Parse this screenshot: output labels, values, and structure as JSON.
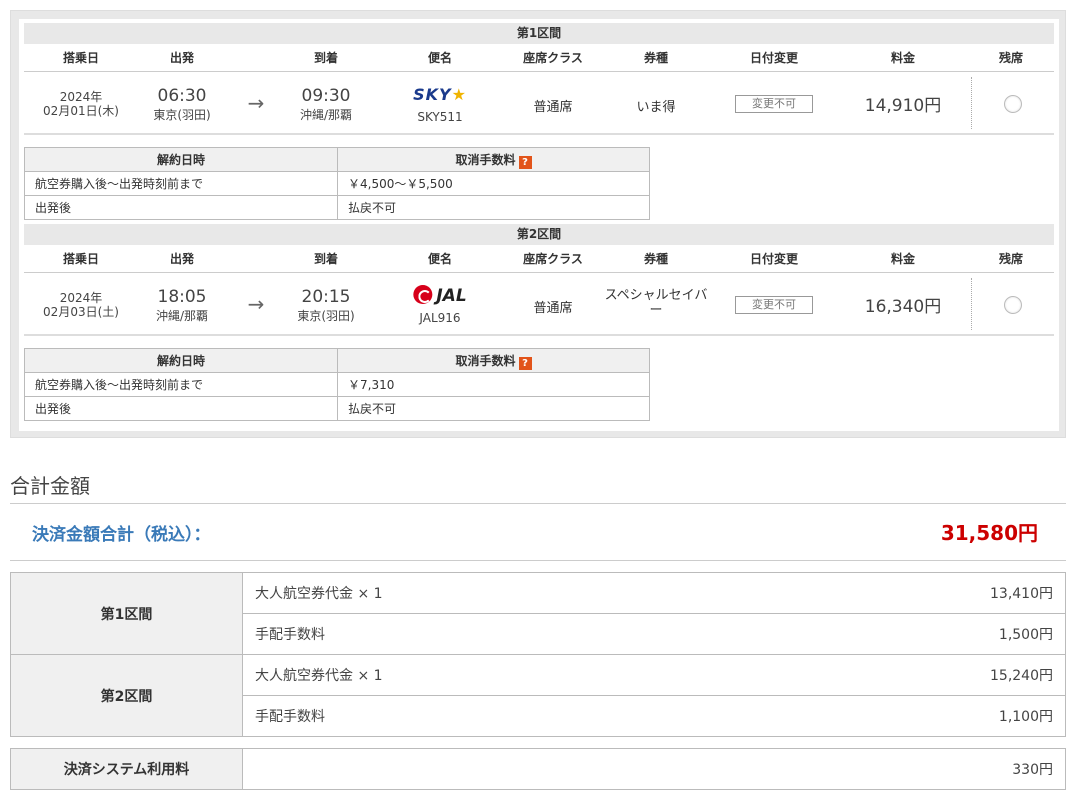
{
  "segments": [
    {
      "title": "第1区間",
      "headers": [
        "搭乗日",
        "出発",
        "到着",
        "便名",
        "座席クラス",
        "券種",
        "日付変更",
        "料金",
        "残席"
      ],
      "flight": {
        "year": "2024年",
        "date": "02月01日(木)",
        "dep_time": "06:30",
        "dep_place": "東京(羽田)",
        "arrow": "→",
        "arr_time": "09:30",
        "arr_place": "沖縄/那覇",
        "airline_logo": "SKY",
        "flight_no": "SKY511",
        "seat_class": "普通席",
        "fare_type": "いま得",
        "date_change": "変更不可",
        "price": "14,910円"
      },
      "cancel": {
        "headers": [
          "解約日時",
          "取消手数料"
        ],
        "help_icon": "?",
        "rows": [
          [
            "航空券購入後～出発時刻前まで",
            "￥4,500～￥5,500"
          ],
          [
            "出発後",
            "払戻不可"
          ]
        ]
      }
    },
    {
      "title": "第2区間",
      "headers": [
        "搭乗日",
        "出発",
        "到着",
        "便名",
        "座席クラス",
        "券種",
        "日付変更",
        "料金",
        "残席"
      ],
      "flight": {
        "year": "2024年",
        "date": "02月03日(土)",
        "dep_time": "18:05",
        "dep_place": "沖縄/那覇",
        "arrow": "→",
        "arr_time": "20:15",
        "arr_place": "東京(羽田)",
        "airline_logo": "JAL",
        "flight_no": "JAL916",
        "seat_class": "普通席",
        "fare_type_1": "スペシャルセイバ",
        "fare_type_2": "ー",
        "date_change": "変更不可",
        "price": "16,340円"
      },
      "cancel": {
        "headers": [
          "解約日時",
          "取消手数料"
        ],
        "help_icon": "?",
        "rows": [
          [
            "航空券購入後～出発時刻前まで",
            "￥7,310"
          ],
          [
            "出発後",
            "払戻不可"
          ]
        ]
      }
    }
  ],
  "total": {
    "title": "合計金額",
    "pay_label": "決済金額合計（税込）：",
    "pay_value": "31,580円"
  },
  "breakdown": [
    {
      "label": "第1区間",
      "items": [
        {
          "name": "大人航空券代金 × 1",
          "amount": "13,410円"
        },
        {
          "name": "手配手数料",
          "amount": "1,500円"
        }
      ]
    },
    {
      "label": "第2区間",
      "items": [
        {
          "name": "大人航空券代金 × 1",
          "amount": "15,240円"
        },
        {
          "name": "手配手数料",
          "amount": "1,100円"
        }
      ]
    }
  ],
  "system_fee": {
    "label": "決済システム利用料",
    "amount": "330円"
  },
  "colors": {
    "pay_label": "#3a7ab8",
    "pay_value": "#cc0000",
    "sky_logo": "#1a3a8c",
    "jal_logo": "#d7001a"
  }
}
